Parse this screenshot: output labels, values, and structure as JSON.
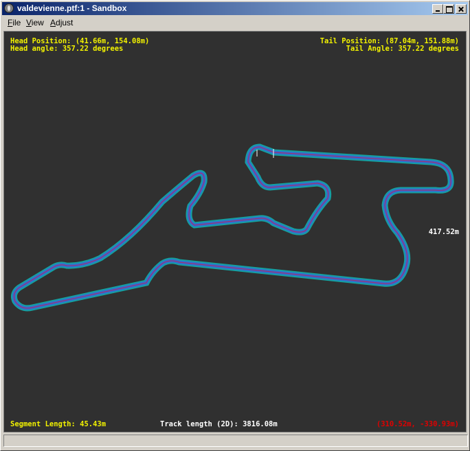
{
  "window": {
    "title": "valdevienne.ptf:1 - Sandbox"
  },
  "menu": {
    "file": {
      "accel": "F",
      "rest": "ile"
    },
    "view": {
      "accel": "V",
      "rest": "iew"
    },
    "adjust": {
      "accel": "A",
      "rest": "djust"
    }
  },
  "hud": {
    "head_position": "Head Position: (41.66m, 154.08m)",
    "head_angle": "Head angle: 357.22 degrees",
    "tail_position": "Tail Position: (87.04m, 151.88m)",
    "tail_angle": "Tail Angle: 357.22 degrees",
    "distance_label": "417.52m",
    "segment_length": "Segment Length: 45.43m",
    "track_length": "Track length (2D): 3816.08m",
    "cursor_coords": "(310.52m, -330.93m)"
  },
  "colors": {
    "background": "#303030",
    "hud_yellow": "#f2f200",
    "hud_white": "#ffffff",
    "hud_red": "#e00000",
    "track_outer": "#14a0a0",
    "track_inner": "#3070d0",
    "track_center": "#a03070"
  },
  "icons": {
    "app": "app-icon",
    "minimize": "minimize-icon",
    "maximize": "maximize-icon",
    "close": "close-icon"
  }
}
